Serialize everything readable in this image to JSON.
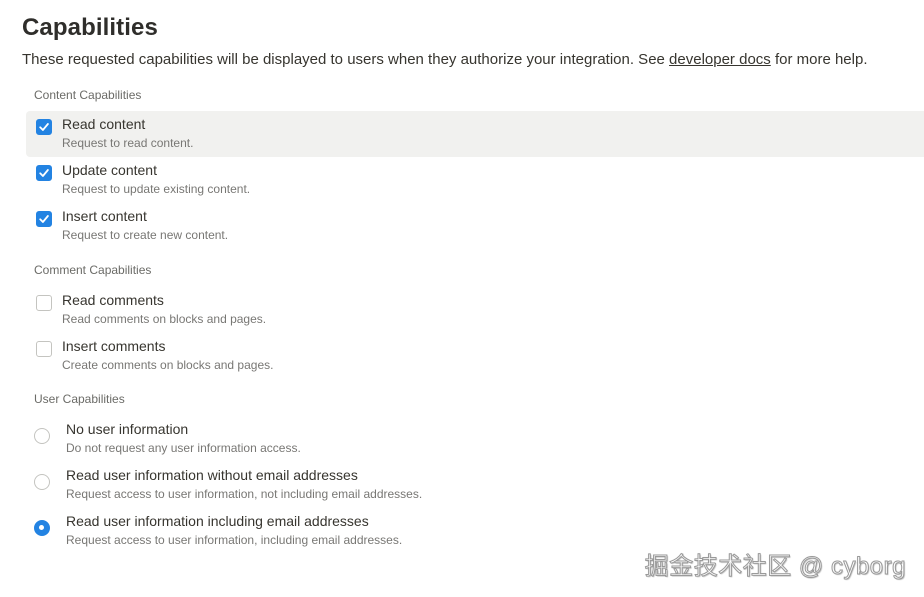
{
  "page": {
    "title": "Capabilities",
    "intro_before": "These requested capabilities will be displayed to users when they authorize your integration. See ",
    "intro_link": "developer docs",
    "intro_after": " for more help."
  },
  "sections": {
    "content": {
      "label": "Content Capabilities",
      "options": [
        {
          "title": "Read content",
          "description": "Request to read content.",
          "checked": true
        },
        {
          "title": "Update content",
          "description": "Request to update existing content.",
          "checked": true
        },
        {
          "title": "Insert content",
          "description": "Request to create new content.",
          "checked": true
        }
      ]
    },
    "comment": {
      "label": "Comment Capabilities",
      "options": [
        {
          "title": "Read comments",
          "description": "Read comments on blocks and pages.",
          "checked": false
        },
        {
          "title": "Insert comments",
          "description": "Create comments on blocks and pages.",
          "checked": false
        }
      ]
    },
    "user": {
      "label": "User Capabilities",
      "options": [
        {
          "title": "No user information",
          "description": "Do not request any user information access.",
          "selected": false
        },
        {
          "title": "Read user information without email addresses",
          "description": "Request access to user information, not including email addresses.",
          "selected": false
        },
        {
          "title": "Read user information including email addresses",
          "description": "Request access to user information, including email addresses.",
          "selected": true
        }
      ]
    }
  },
  "watermark": "掘金技术社区 @ cyborg",
  "colors": {
    "accent": "#2383e2",
    "hover_row": "#f1f1ef",
    "text": "#37352f",
    "muted": "#787774"
  }
}
